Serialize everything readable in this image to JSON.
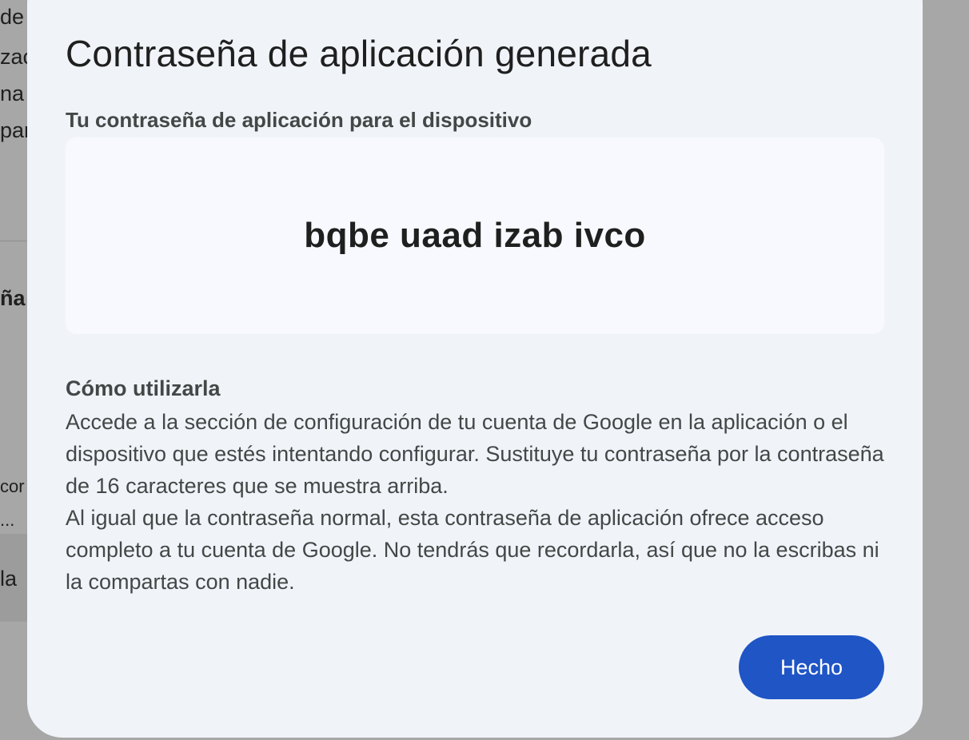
{
  "background": {
    "fragments": [
      "de",
      "zac",
      "na",
      "par",
      "ña",
      "cor",
      "...",
      "la"
    ]
  },
  "dialog": {
    "title": "Contraseña de aplicación generada",
    "password_label": "Tu contraseña de aplicación para el dispositivo",
    "password_value": "bqbe uaad izab ivco",
    "howto_title": "Cómo utilizarla",
    "howto_paragraphs": [
      "Accede a la sección de configuración de tu cuenta de Google en la aplicación o el dispositivo que estés intentando configurar. Sustituye tu contraseña por la contraseña de 16 caracteres que se muestra arriba.",
      "Al igual que la contraseña normal, esta contraseña de aplicación ofrece acceso completo a tu cuenta de Google. No tendrás que recordarla, así que no la escribas ni la compartas con nadie."
    ],
    "done_label": "Hecho"
  },
  "colors": {
    "scrim": "#a7a7a7",
    "dialog_background": "#f0f4f9",
    "password_box": "#f8f9fe",
    "primary_button": "#1f55c5"
  }
}
